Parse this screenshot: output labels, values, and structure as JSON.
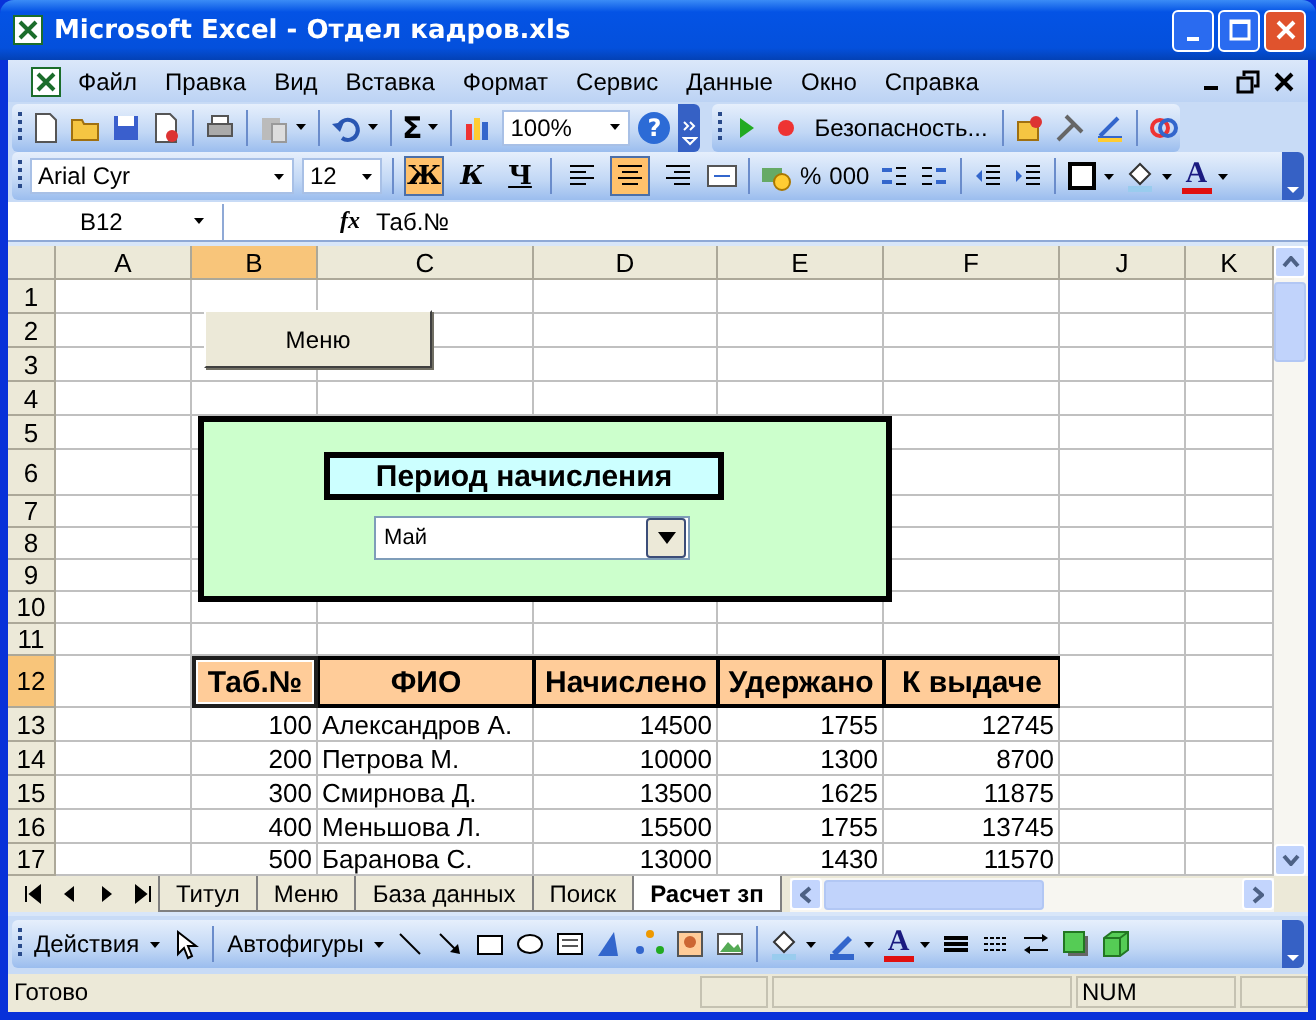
{
  "window": {
    "title": "Microsoft Excel - Отдел кадров.xls"
  },
  "menu": [
    {
      "label": "Файл"
    },
    {
      "label": "Правка"
    },
    {
      "label": "Вид"
    },
    {
      "label": "Вставка"
    },
    {
      "label": "Формат"
    },
    {
      "label": "Сервис"
    },
    {
      "label": "Данные"
    },
    {
      "label": "Окно"
    },
    {
      "label": "Справка"
    }
  ],
  "standard_toolbar": {
    "sum": "Σ",
    "zoom": "100%",
    "help": "?",
    "security": "Безопасность..."
  },
  "formatting_toolbar": {
    "font": "Arial Cyr",
    "size": "12",
    "style_buttons": [
      {
        "label": "Ж",
        "kind": "bold",
        "selected": true
      },
      {
        "label": "К",
        "kind": "italic",
        "selected": false
      },
      {
        "label": "Ч",
        "kind": "underline",
        "selected": false
      }
    ],
    "align_buttons": [
      {
        "kind": "left",
        "selected": false
      },
      {
        "kind": "center",
        "selected": true
      },
      {
        "kind": "right",
        "selected": false
      }
    ],
    "percent": "%",
    "thousands": "000",
    "font_color": "A"
  },
  "formula_bar": {
    "name_box": "B12",
    "fx": "fx",
    "formula": "Таб.№"
  },
  "sheet": {
    "columns": [
      {
        "label": "A",
        "selected": false
      },
      {
        "label": "B",
        "selected": true
      },
      {
        "label": "C",
        "selected": false
      },
      {
        "label": "D",
        "selected": false
      },
      {
        "label": "E",
        "selected": false
      },
      {
        "label": "F",
        "selected": false
      },
      {
        "label": "J",
        "selected": false
      },
      {
        "label": "K",
        "selected": false
      }
    ],
    "rows": [
      {
        "label": "1",
        "selected": false
      },
      {
        "label": "2",
        "selected": false
      },
      {
        "label": "3",
        "selected": false
      },
      {
        "label": "4",
        "selected": false
      },
      {
        "label": "5",
        "selected": false
      },
      {
        "label": "6",
        "selected": false
      },
      {
        "label": "7",
        "selected": false
      },
      {
        "label": "8",
        "selected": false
      },
      {
        "label": "9",
        "selected": false
      },
      {
        "label": "10",
        "selected": false
      },
      {
        "label": "11",
        "selected": false
      },
      {
        "label": "12",
        "selected": true
      },
      {
        "label": "13",
        "selected": false
      },
      {
        "label": "14",
        "selected": false
      },
      {
        "label": "15",
        "selected": false
      },
      {
        "label": "16",
        "selected": false
      },
      {
        "label": "17",
        "selected": false
      }
    ],
    "menu_button": "Меню",
    "panel": {
      "title": "Период начисления",
      "dropdown": "Май"
    },
    "table": {
      "columns": [
        "Таб.№",
        "ФИО",
        "Начислено",
        "Удержано",
        "К выдаче"
      ],
      "rows": [
        [
          "100",
          "Александров А.",
          "14500",
          "1755",
          "12745"
        ],
        [
          "200",
          "Петрова М.",
          "10000",
          "1300",
          "8700"
        ],
        [
          "300",
          "Смирнова Д.",
          "13500",
          "1625",
          "11875"
        ],
        [
          "400",
          "Меньшова Л.",
          "15500",
          "1755",
          "13745"
        ],
        [
          "500",
          "Баранова С.",
          "13000",
          "1430",
          "11570"
        ]
      ]
    }
  },
  "sheet_tabs": [
    {
      "label": "Титул",
      "selected": false
    },
    {
      "label": "Меню",
      "selected": false
    },
    {
      "label": "База данных",
      "selected": false
    },
    {
      "label": "Поиск",
      "selected": false
    },
    {
      "label": "Расчет зп",
      "selected": true
    }
  ],
  "drawing_toolbar": {
    "actions": "Действия",
    "autoshapes": "Автофигуры",
    "font_color": "A"
  },
  "status_bar": {
    "text": "Готово",
    "num": "NUM"
  }
}
